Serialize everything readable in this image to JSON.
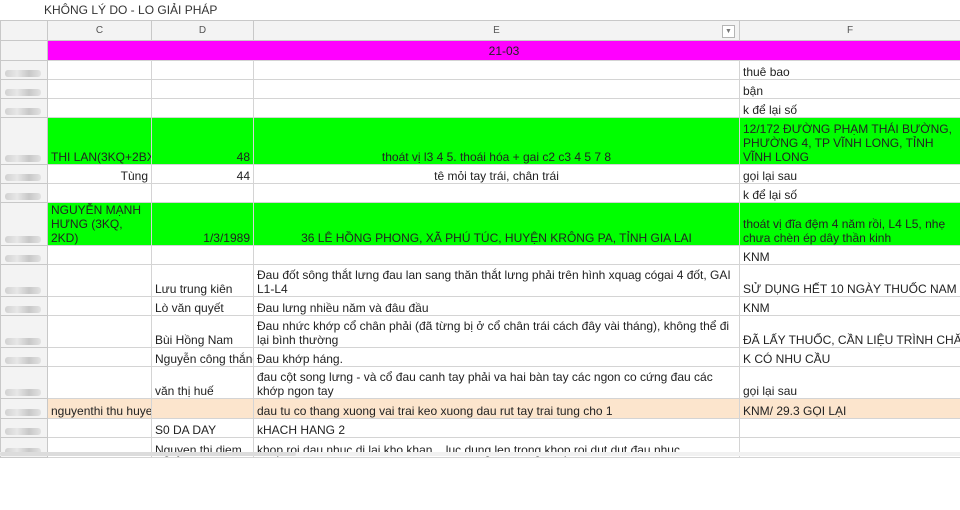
{
  "sheet_title": "KHÔNG LÝ DO - LO GIẢI PHÁP",
  "columns": [
    "C",
    "D",
    "E",
    "F"
  ],
  "date_band": "21-03",
  "rows": [
    {
      "c": "",
      "d": "",
      "e": "",
      "f": "thuê bao"
    },
    {
      "c": "",
      "d": "",
      "e": "",
      "f": "bận"
    },
    {
      "c": "",
      "d": "",
      "e": "",
      "f": "k để lại số"
    },
    {
      "c": "THI LAN(3KQ+2BXT)",
      "d": "48",
      "e": "thoát vị l3 4 5. thoái hóa + gai c2 c3 4 5 7 8",
      "f": "12/172 ĐƯỜNG PHẠM THÁI BƯỜNG, PHƯỜNG 4, TP VĨNH LONG, TỈNH VĨNH LONG"
    },
    {
      "c": "Tùng",
      "d": "44",
      "e": "tê mỏi tay trái, chân trái",
      "f": "gọi lại sau"
    },
    {
      "c": "",
      "d": "",
      "e": "",
      "f": "k để lại số"
    },
    {
      "c": "NGUYỄN MẠNH HƯNG (3KQ, 2KD)",
      "d": "1/3/1989",
      "e": "36 LÊ HỒNG PHONG, XÃ PHÚ TÚC, HUYỆN KRÔNG PA, TỈNH GIA LAI",
      "f": "thoát vị đĩa đệm 4 năm rồi, L4 L5, nhẹ chưa chèn ép dây thần kinh"
    },
    {
      "c": "",
      "d": "",
      "e": "",
      "f": "KNM"
    },
    {
      "c": "",
      "d": "Lưu trung kiên",
      "e": "Đau đốt sông thắt lưng đau lan sang thăn thắt lưng phải trên hình xquag cógai 4 đốt, GAI L1-L4",
      "f": "SỬ DỤNG HẾT 10 NGÀY THUỐC NAM"
    },
    {
      "c": "",
      "d": "Lò văn quyết",
      "e": "Đau lưng nhiều năm và đâu đầu",
      "f": "KNM"
    },
    {
      "c": "",
      "d": "Bùi Hồng Nam",
      "e": "Đau nhức khớp cổ chân phải (đã từng bị ở cổ chân trái cách đây vài tháng), không thể đi lại bình thường",
      "f": "ĐÃ LẤY THUỐC, CẦN LIỆU TRÌNH CHĂM"
    },
    {
      "c": "",
      "d": "Nguyễn công thắng",
      "e": "Đau khớp háng.",
      "f": "K CÓ NHU CẦU"
    },
    {
      "c": "",
      "d": "văn thị huế",
      "e": "đau cột song lưng - và cổ đau canh tay phải va hai bàn tay các ngon co cứng đau các khớp ngon tay",
      "f": "gọi lại sau"
    },
    {
      "c": "nguyenthi thu huyen",
      "d": "",
      "e": "dau tu co thang xuong vai trai keo xuong dau rut tay trai tung cho 1",
      "f": "KNM/ 29.3 GỌI LẠI"
    },
    {
      "c": "",
      "d": "S0 DA DAY",
      "e": "kHACH HANG 2",
      "f": ""
    },
    {
      "c": "",
      "d": "Nguyen thi diem",
      "e": "khop roi dau nhuc di lai kho khan .. luc dung len trong khop roi dut dụt đau nhuc",
      "f": ""
    }
  ]
}
